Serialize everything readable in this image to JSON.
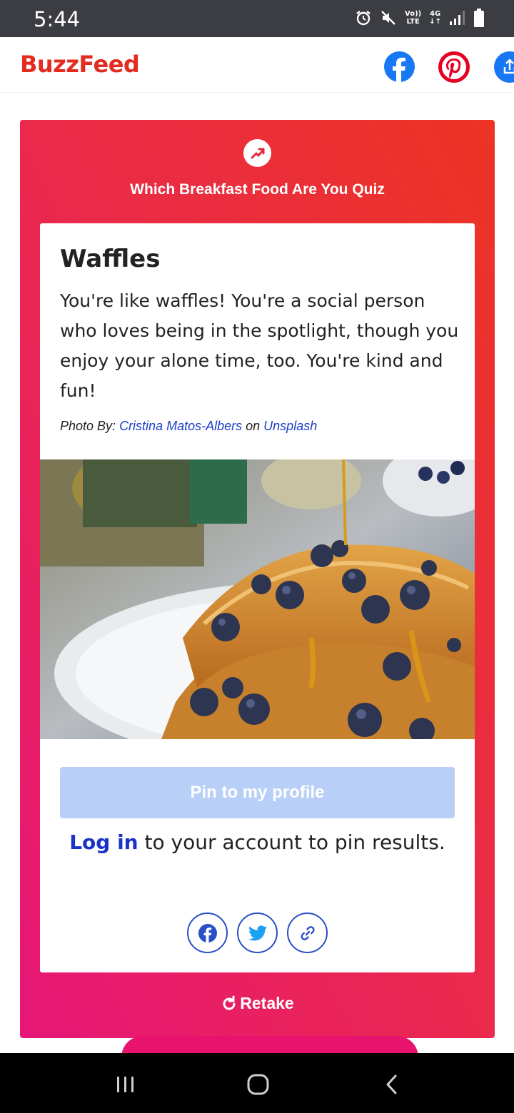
{
  "status_bar": {
    "time": "5:44",
    "volte_top": "Vo))",
    "volte_bottom": "LTE",
    "network": "4G",
    "icons": [
      "alarm-icon",
      "mute-icon",
      "volte-icon",
      "4g-data-icon",
      "signal-icon",
      "battery-icon"
    ]
  },
  "header": {
    "logo": "BuzzFeed",
    "share_icons": [
      "facebook-icon",
      "pinterest-icon",
      "share-icon"
    ]
  },
  "quiz": {
    "title": "Which Breakfast Food Are You Quiz",
    "badge_icon": "trending-icon",
    "result": {
      "title": "Waffles",
      "description": "You're like waffles! You're a social person who loves being in the spotlight, though you enjoy your alone time, too. You're kind and fun!",
      "credit_prefix": "Photo By:",
      "photographer": "Cristina Matos-Albers",
      "credit_on": "on",
      "credit_source": "Unsplash",
      "image_alt": "Stack of waffles with blueberries and syrup"
    },
    "pin_button": "Pin to my profile",
    "login_link": "Log in",
    "login_text": " to your account to pin results.",
    "social_buttons": [
      "facebook-icon",
      "twitter-icon",
      "link-icon"
    ],
    "retake": "Retake"
  },
  "colors": {
    "brand": "#e32c1f",
    "card_top": "#ec3323",
    "card_bottom": "#e71678",
    "pin_disabled": "#b8cff7",
    "link": "#1a32c8"
  },
  "nav_bar": {
    "buttons": [
      "recent-apps-icon",
      "home-icon",
      "back-icon"
    ]
  }
}
